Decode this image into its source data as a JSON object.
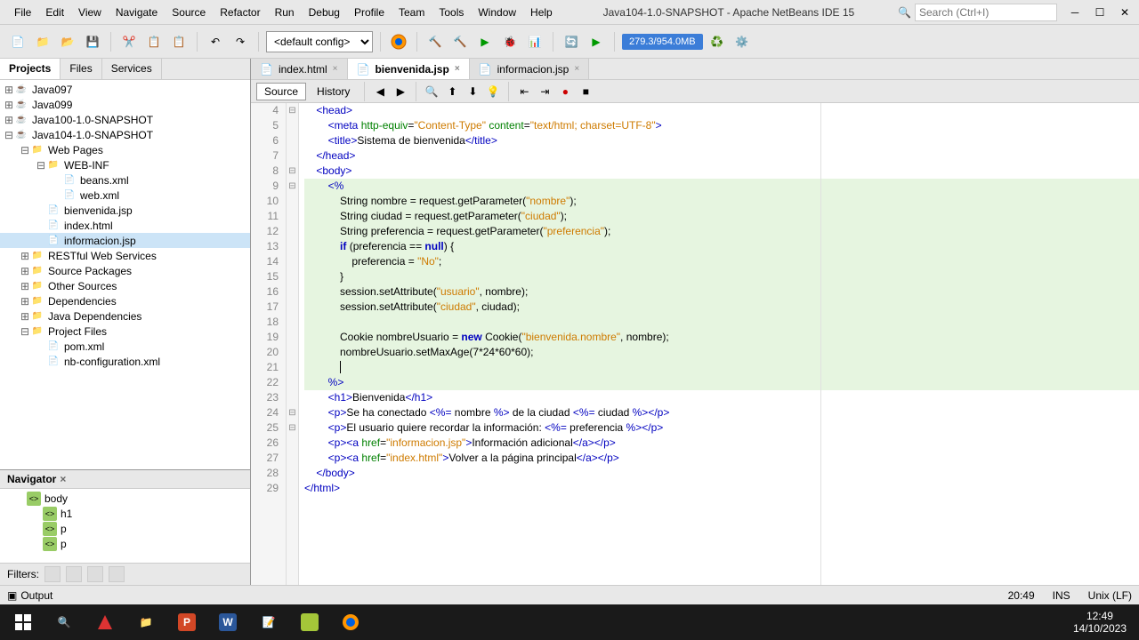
{
  "window": {
    "title": "Java104-1.0-SNAPSHOT - Apache NetBeans IDE 15",
    "search_placeholder": "Search (Ctrl+I)"
  },
  "menu": [
    "File",
    "Edit",
    "View",
    "Navigate",
    "Source",
    "Refactor",
    "Run",
    "Debug",
    "Profile",
    "Team",
    "Tools",
    "Window",
    "Help"
  ],
  "toolbar": {
    "config": "<default config>",
    "memory": "279.3/954.0MB"
  },
  "project_tabs": {
    "projects": "Projects",
    "files": "Files",
    "services": "Services"
  },
  "tree": [
    {
      "d": 0,
      "exp": "+",
      "icon": "☕",
      "label": "Java097"
    },
    {
      "d": 0,
      "exp": "+",
      "icon": "☕",
      "label": "Java099"
    },
    {
      "d": 0,
      "exp": "+",
      "icon": "☕",
      "label": "Java100-1.0-SNAPSHOT"
    },
    {
      "d": 0,
      "exp": "-",
      "icon": "☕",
      "label": "Java104-1.0-SNAPSHOT"
    },
    {
      "d": 1,
      "exp": "-",
      "icon": "📁",
      "label": "Web Pages"
    },
    {
      "d": 2,
      "exp": "-",
      "icon": "📁",
      "label": "WEB-INF"
    },
    {
      "d": 3,
      "exp": "",
      "icon": "📄",
      "label": "beans.xml"
    },
    {
      "d": 3,
      "exp": "",
      "icon": "📄",
      "label": "web.xml"
    },
    {
      "d": 2,
      "exp": "",
      "icon": "📄",
      "label": "bienvenida.jsp"
    },
    {
      "d": 2,
      "exp": "",
      "icon": "📄",
      "label": "index.html"
    },
    {
      "d": 2,
      "exp": "",
      "icon": "📄",
      "label": "informacion.jsp",
      "sel": true
    },
    {
      "d": 1,
      "exp": "+",
      "icon": "📁",
      "label": "RESTful Web Services"
    },
    {
      "d": 1,
      "exp": "+",
      "icon": "📁",
      "label": "Source Packages"
    },
    {
      "d": 1,
      "exp": "+",
      "icon": "📁",
      "label": "Other Sources"
    },
    {
      "d": 1,
      "exp": "+",
      "icon": "📁",
      "label": "Dependencies"
    },
    {
      "d": 1,
      "exp": "+",
      "icon": "📁",
      "label": "Java Dependencies"
    },
    {
      "d": 1,
      "exp": "-",
      "icon": "📁",
      "label": "Project Files"
    },
    {
      "d": 2,
      "exp": "",
      "icon": "📄",
      "label": "pom.xml"
    },
    {
      "d": 2,
      "exp": "",
      "icon": "📄",
      "label": "nb-configuration.xml"
    }
  ],
  "navigator": {
    "title": "Navigator",
    "items": [
      {
        "d": 0,
        "icon": "<>",
        "label": "body"
      },
      {
        "d": 1,
        "icon": "<>",
        "label": "h1"
      },
      {
        "d": 1,
        "icon": "<>",
        "label": "p"
      },
      {
        "d": 1,
        "icon": "<>",
        "label": "p"
      }
    ],
    "filters_label": "Filters:"
  },
  "editor": {
    "tabs": [
      {
        "label": "index.html",
        "active": false
      },
      {
        "label": "bienvenida.jsp",
        "active": true
      },
      {
        "label": "informacion.jsp",
        "active": false
      }
    ],
    "views": {
      "source": "Source",
      "history": "History"
    },
    "lines_start": 4,
    "lines_end": 29
  },
  "status": {
    "output": "Output",
    "caret": "20:49",
    "mode": "INS",
    "encoding": "Unix (LF)"
  },
  "taskbar": {
    "time": "12:49",
    "date": "14/10/2023"
  }
}
